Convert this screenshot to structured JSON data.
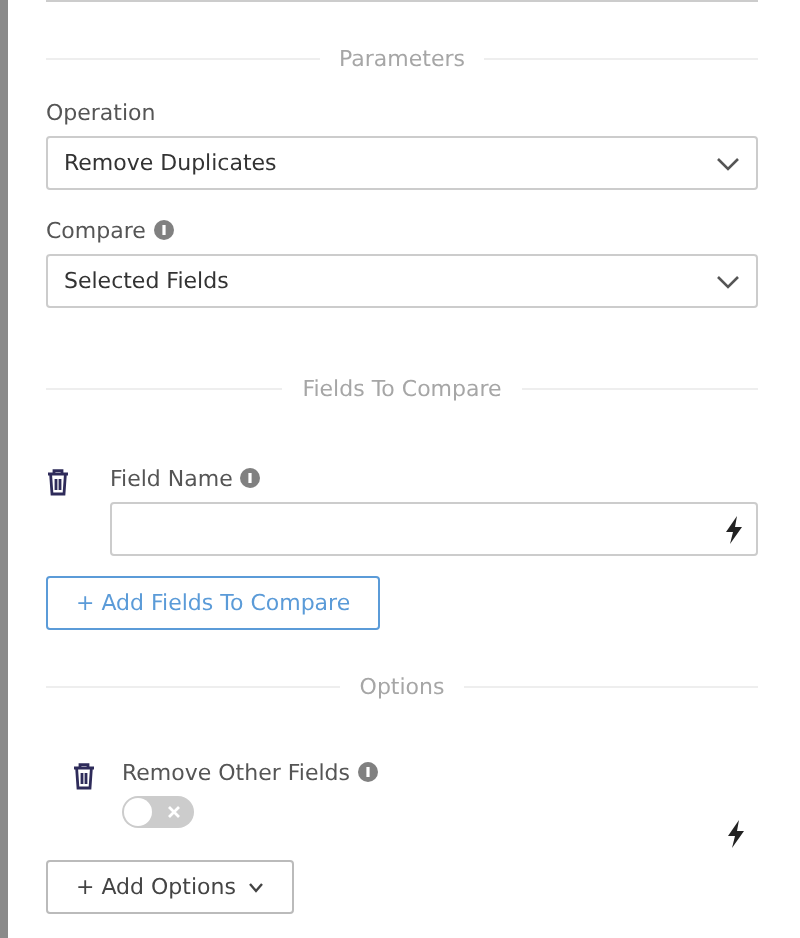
{
  "sections": [
    {
      "title": "Parameters",
      "kind": "selects",
      "fields": [
        {
          "label": "Operation",
          "info": false,
          "value": "Remove Duplicates"
        },
        {
          "label": "Compare",
          "info": true,
          "value": "Selected Fields"
        }
      ]
    },
    {
      "title": "Fields To Compare",
      "kind": "list",
      "items": [
        {
          "kind": "text",
          "label": "Field Name",
          "info": true,
          "value": ""
        }
      ],
      "add_button": {
        "label": "+ Add Fields To Compare",
        "dropdown": false
      }
    },
    {
      "title": "Options",
      "kind": "list",
      "items": [
        {
          "kind": "toggle",
          "label": "Remove Other Fields",
          "info": true,
          "on": false
        }
      ],
      "add_button": {
        "label": "+ Add Options",
        "dropdown": true
      }
    }
  ]
}
